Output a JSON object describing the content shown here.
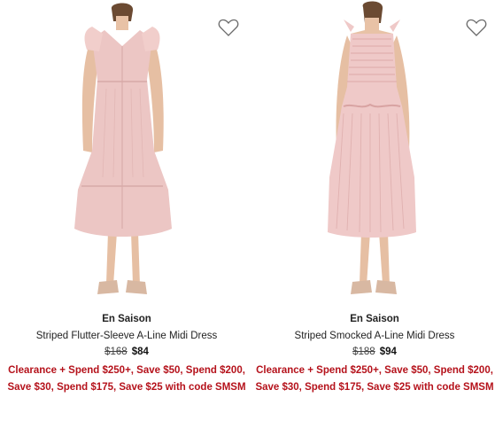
{
  "products": [
    {
      "brand": "En Saison",
      "name": "Striped Flutter-Sleeve A-Line Midi Dress",
      "original_price": "$168",
      "sale_price": "$84",
      "promo": "Clearance + Spend $250+, Save $50, Spend $200, Save $30, Spend $175, Save $25 with code SMSM",
      "favorite_icon": "heart-outline-icon",
      "dress_color": "#ecc6c4"
    },
    {
      "brand": "En Saison",
      "name": "Striped Smocked A-Line Midi Dress",
      "original_price": "$188",
      "sale_price": "$94",
      "promo": "Clearance + Spend $250+, Save $50, Spend $200, Save $30, Spend $175, Save $25 with code SMSM",
      "favorite_icon": "heart-outline-icon",
      "dress_color": "#efc9c8"
    }
  ],
  "colors": {
    "promo": "#b5121b",
    "text": "#222222",
    "background": "#ffffff"
  }
}
